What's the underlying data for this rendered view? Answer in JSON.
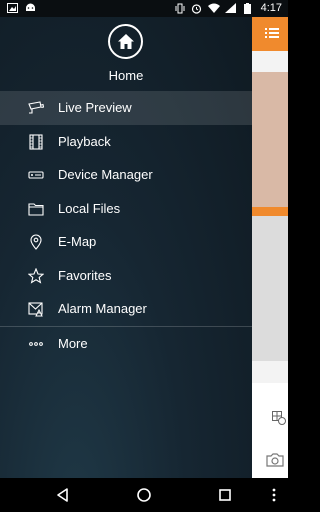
{
  "status_bar": {
    "time": "4:17",
    "left_icons": [
      "image-notification-icon",
      "android-debug-icon"
    ],
    "right_icons": [
      "vibrate-icon",
      "alarm-icon",
      "wifi-icon",
      "signal-icon",
      "battery-icon"
    ]
  },
  "drawer": {
    "header": {
      "icon": "home-icon",
      "title": "Home"
    },
    "items": [
      {
        "icon": "cctv-camera-icon",
        "label": "Live Preview",
        "active": true
      },
      {
        "icon": "film-strip-icon",
        "label": "Playback",
        "active": false
      },
      {
        "icon": "device-icon",
        "label": "Device Manager",
        "active": false
      },
      {
        "icon": "folder-icon",
        "label": "Local Files",
        "active": false
      },
      {
        "icon": "map-pin-icon",
        "label": "E-Map",
        "active": false
      },
      {
        "icon": "star-icon",
        "label": "Favorites",
        "active": false
      },
      {
        "icon": "alarm-envelope-icon",
        "label": "Alarm Manager",
        "active": false
      }
    ],
    "more": {
      "icon": "more-dots-icon",
      "label": "More"
    }
  },
  "colors": {
    "accent": "#f08a2d",
    "drawer_bg": "#162632",
    "tile": "#d9b9a6"
  },
  "nav_bar": {
    "buttons": [
      "back-icon",
      "home-nav-icon",
      "recents-icon",
      "overflow-icon"
    ]
  }
}
